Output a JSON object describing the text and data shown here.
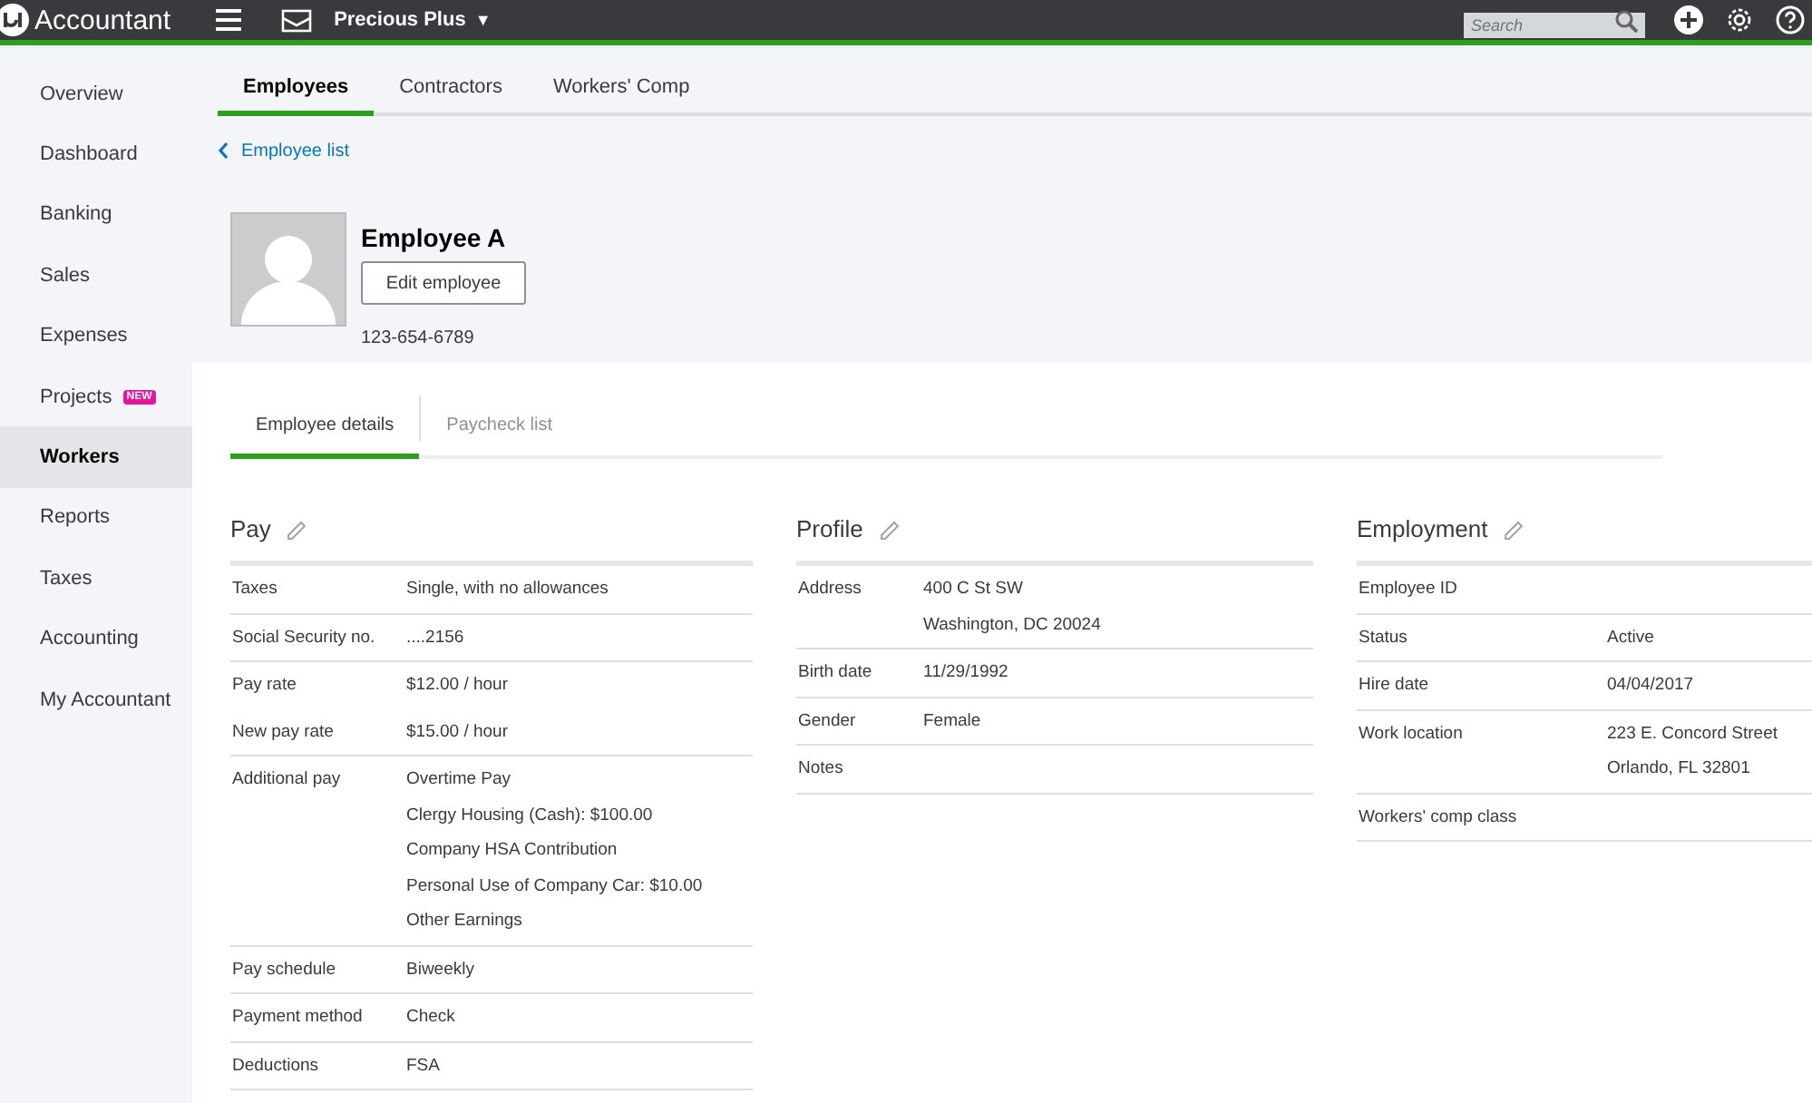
{
  "topbar": {
    "brand": "Accountant",
    "company": "Precious Plus",
    "company_caret": "▼",
    "search": {
      "placeholder": "Search"
    }
  },
  "sidebar": {
    "items": [
      {
        "label": "Overview",
        "selected": false
      },
      {
        "label": "Dashboard",
        "selected": false
      },
      {
        "label": "Banking",
        "selected": false
      },
      {
        "label": "Sales",
        "selected": false
      },
      {
        "label": "Expenses",
        "selected": false
      },
      {
        "label": "Projects",
        "selected": false,
        "badge": "NEW"
      },
      {
        "label": "Workers",
        "selected": true
      },
      {
        "label": "Reports",
        "selected": false
      },
      {
        "label": "Taxes",
        "selected": false
      },
      {
        "label": "Accounting",
        "selected": false
      },
      {
        "label": "My Accountant",
        "selected": false
      }
    ]
  },
  "tabs": [
    {
      "label": "Employees",
      "selected": true
    },
    {
      "label": "Contractors",
      "selected": false
    },
    {
      "label": "Workers' Comp",
      "selected": false
    }
  ],
  "back_link": "Employee list",
  "employee": {
    "name": "Employee A",
    "edit_button": "Edit employee",
    "phone": "123-654-6789"
  },
  "detail_tabs": [
    {
      "label": "Employee details",
      "selected": true
    },
    {
      "label": "Paycheck list",
      "selected": false
    }
  ],
  "sections": [
    {
      "title": "Pay",
      "groups": [
        [
          {
            "label": "Taxes",
            "values": [
              "Single, with no allowances"
            ]
          }
        ],
        [
          {
            "label": "Social Security no.",
            "values": [
              "....2156"
            ]
          }
        ],
        [
          {
            "label": "Pay rate",
            "values": [
              "$12.00 / hour"
            ]
          },
          {
            "label": "New pay rate",
            "values": [
              "$15.00 / hour"
            ]
          }
        ],
        [
          {
            "label": "Additional pay",
            "values": [
              "Overtime Pay",
              "Clergy Housing (Cash): $100.00",
              "Company HSA Contribution",
              "Personal Use of Company Car: $10.00",
              "Other Earnings"
            ]
          }
        ],
        [
          {
            "label": "Pay schedule",
            "values": [
              "Biweekly"
            ]
          }
        ],
        [
          {
            "label": "Payment method",
            "values": [
              "Check"
            ]
          }
        ],
        [
          {
            "label": "Deductions",
            "values": [
              "FSA"
            ]
          }
        ]
      ]
    },
    {
      "title": "Profile",
      "groups": [
        [
          {
            "label": "Address",
            "values": [
              "400 C St SW",
              "Washington, DC 20024"
            ]
          }
        ],
        [
          {
            "label": "Birth date",
            "values": [
              "11/29/1992"
            ]
          }
        ],
        [
          {
            "label": "Gender",
            "values": [
              "Female"
            ]
          }
        ],
        [
          {
            "label": "Notes"
          }
        ]
      ]
    },
    {
      "title": "Employment",
      "groups": [
        [
          {
            "label": "Employee ID"
          }
        ],
        [
          {
            "label": "Status",
            "values": [
              "Active"
            ]
          }
        ],
        [
          {
            "label": "Hire date",
            "values": [
              "04/04/2017"
            ]
          }
        ],
        [
          {
            "label": "Work location",
            "values": [
              "223 E. Concord Street",
              "Orlando, FL 32801"
            ]
          }
        ],
        [
          {
            "label": "Workers' comp class"
          }
        ]
      ]
    }
  ]
}
